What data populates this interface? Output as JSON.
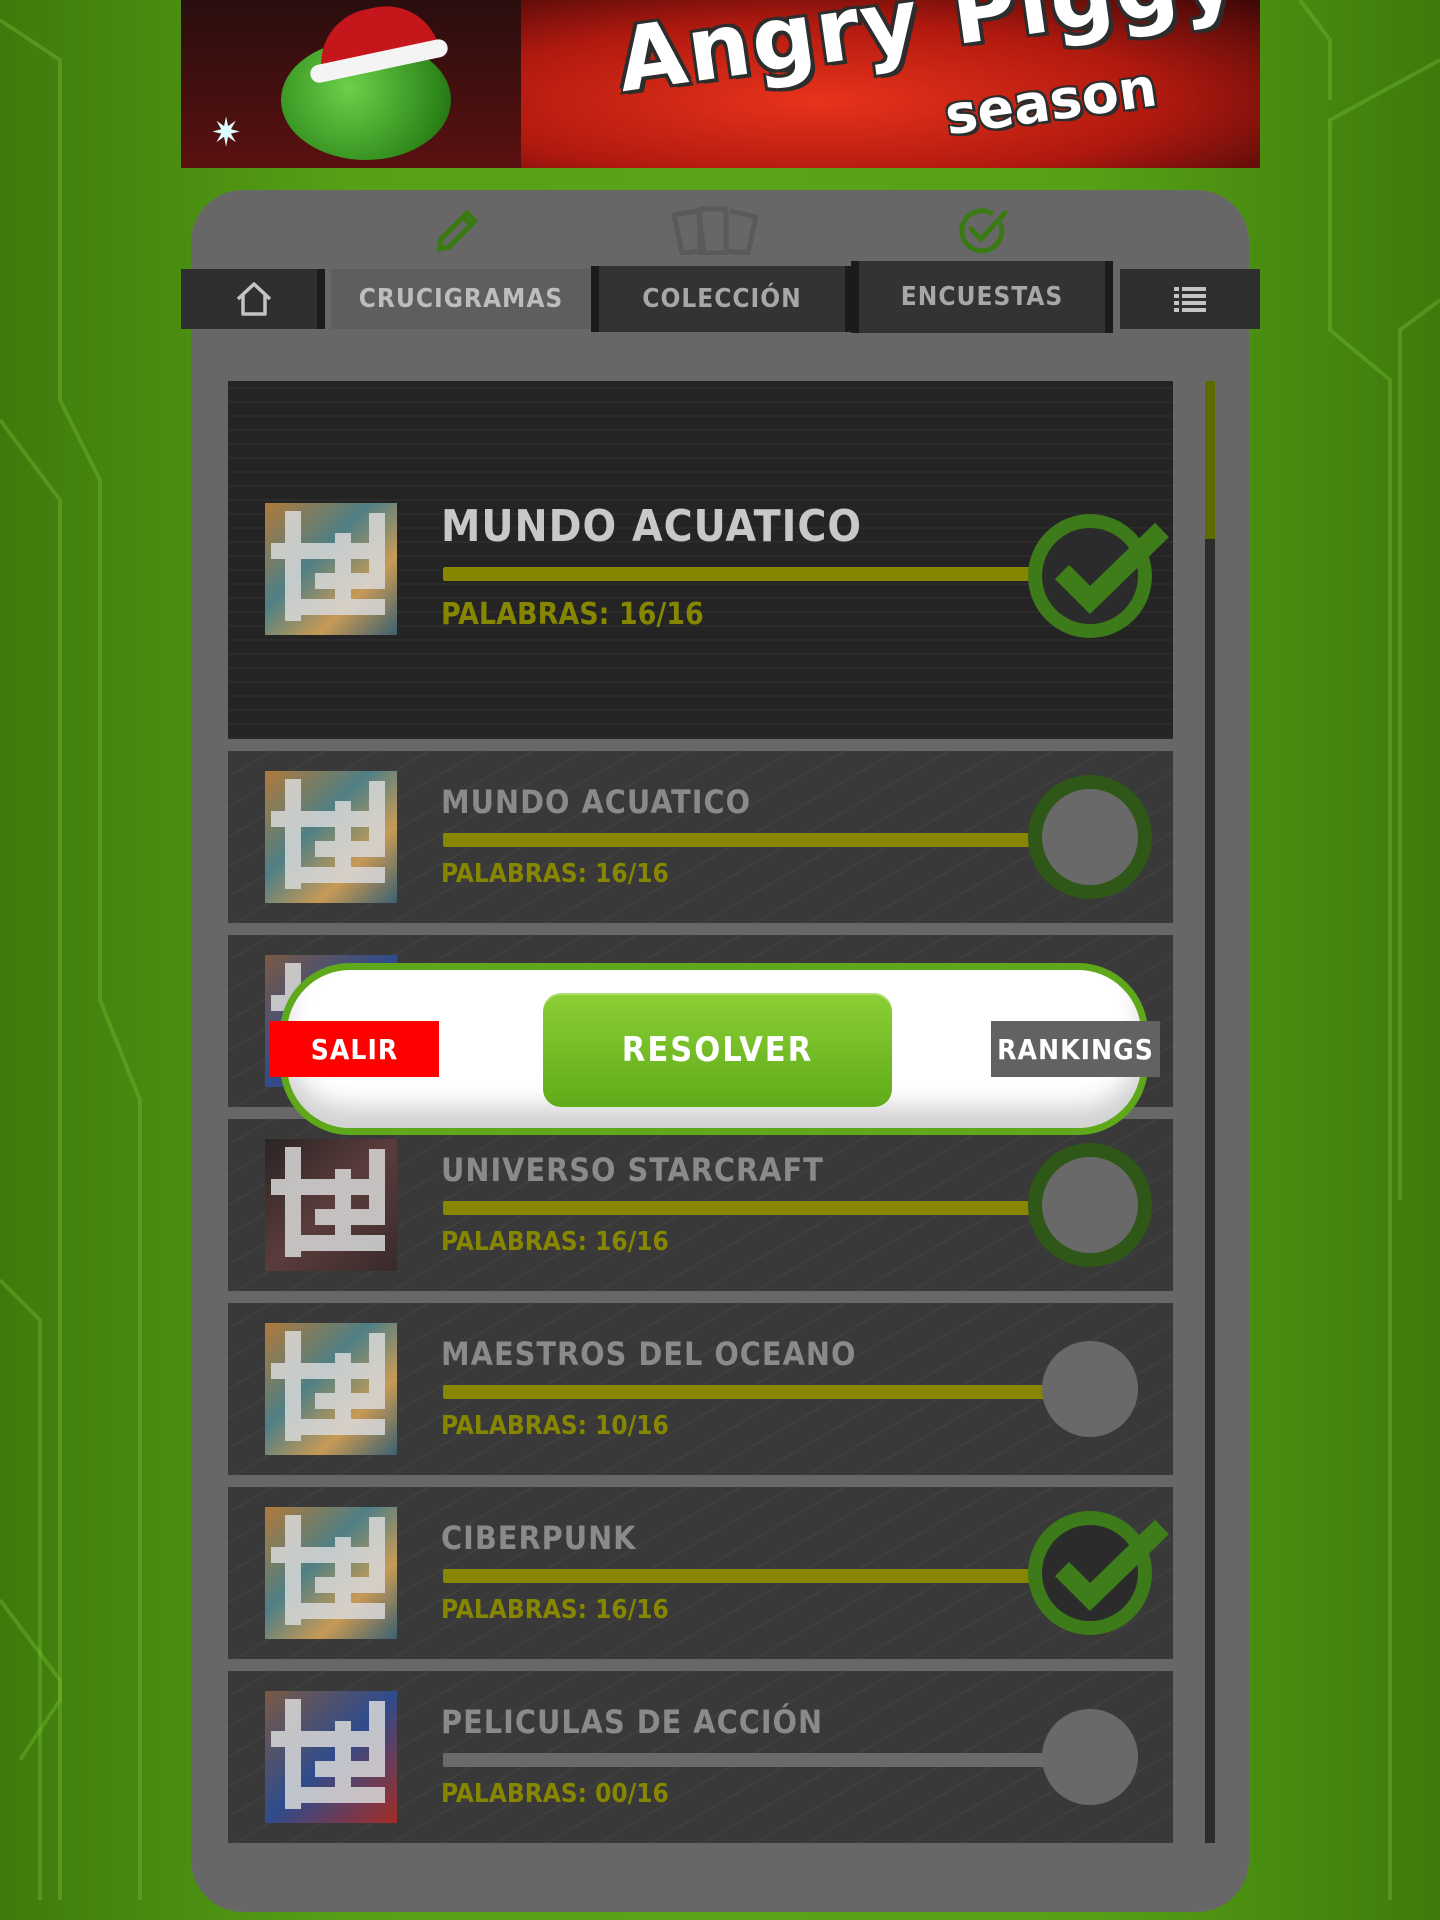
{
  "banner": {
    "title": "Angry Piggy",
    "subtitle": "season"
  },
  "nav": {
    "tabs": [
      {
        "label": "CRUCIGRAMAS",
        "icon": "pencil-icon"
      },
      {
        "label": "COLECCIÓN",
        "icon": "cards-icon"
      },
      {
        "label": "ENCUESTAS",
        "icon": "check-circle-icon"
      }
    ],
    "home_icon": "home-icon",
    "menu_icon": "list-menu-icon"
  },
  "crosswords": [
    {
      "title": "MUNDO ACUATICO",
      "words": "PALABRAS: 16/16",
      "progress": 1.0,
      "status": "completed"
    },
    {
      "title": "MUNDO ACUATICO",
      "words": "PALABRAS: 16/16",
      "progress": 1.0,
      "status": "pending"
    },
    {
      "title": "",
      "words": "",
      "progress": 1.0,
      "status": "hidden"
    },
    {
      "title": "UNIVERSO STARCRAFT",
      "words": "PALABRAS: 16/16",
      "progress": 1.0,
      "status": "pending"
    },
    {
      "title": "MAESTROS DEL OCEANO",
      "words": "PALABRAS: 10/16",
      "progress": 1.0,
      "status": "empty"
    },
    {
      "title": "CIBERPUNK",
      "words": "PALABRAS: 16/16",
      "progress": 1.0,
      "status": "completed"
    },
    {
      "title": "PELICULAS DE ACCIÓN",
      "words": "PALABRAS: 00/16",
      "progress": 0.0,
      "status": "empty"
    }
  ],
  "popup": {
    "salir": "SALIR",
    "resolver": "RESOLVER",
    "rankings": "RANKINGS"
  },
  "colors": {
    "accent_green": "#5fa81b",
    "progress": "#868600",
    "salir_red": "#ff0000"
  }
}
